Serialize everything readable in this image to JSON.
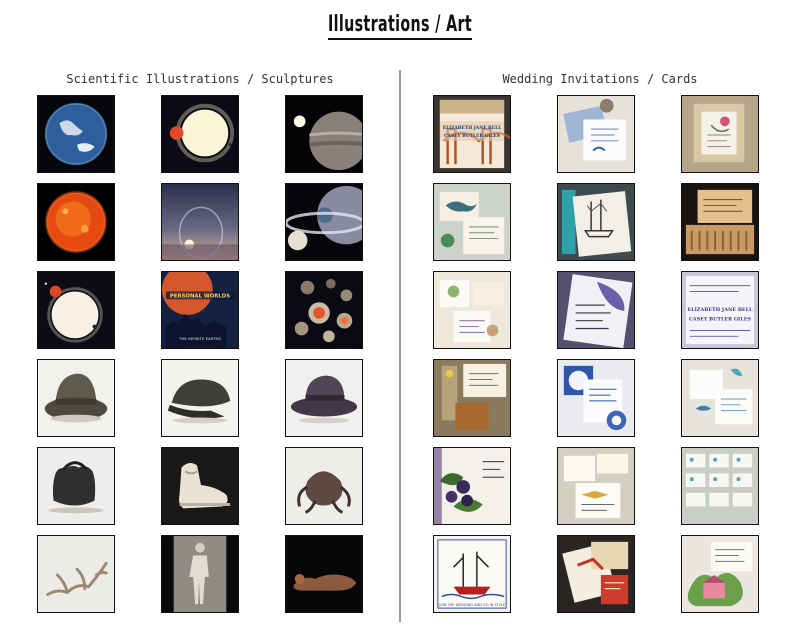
{
  "header": {
    "title": "Illustrations / Art"
  },
  "sections": {
    "left": {
      "title": "Scientific Illustrations / Sculptures"
    },
    "right": {
      "title": "Wedding Invitations / Cards"
    }
  },
  "poster_text": {
    "line1": "THE INFINITE EARTHS",
    "line2": "PERSONAL WORLDS",
    "line3": "THE INFINITE EARTHS"
  },
  "invitation_text": {
    "names_1": "ELIZABETH JANE BELL",
    "names_2": "CASEY BUTLER GILES",
    "footer": "JOIN THE WEDDING AND GO IN STYLE"
  }
}
